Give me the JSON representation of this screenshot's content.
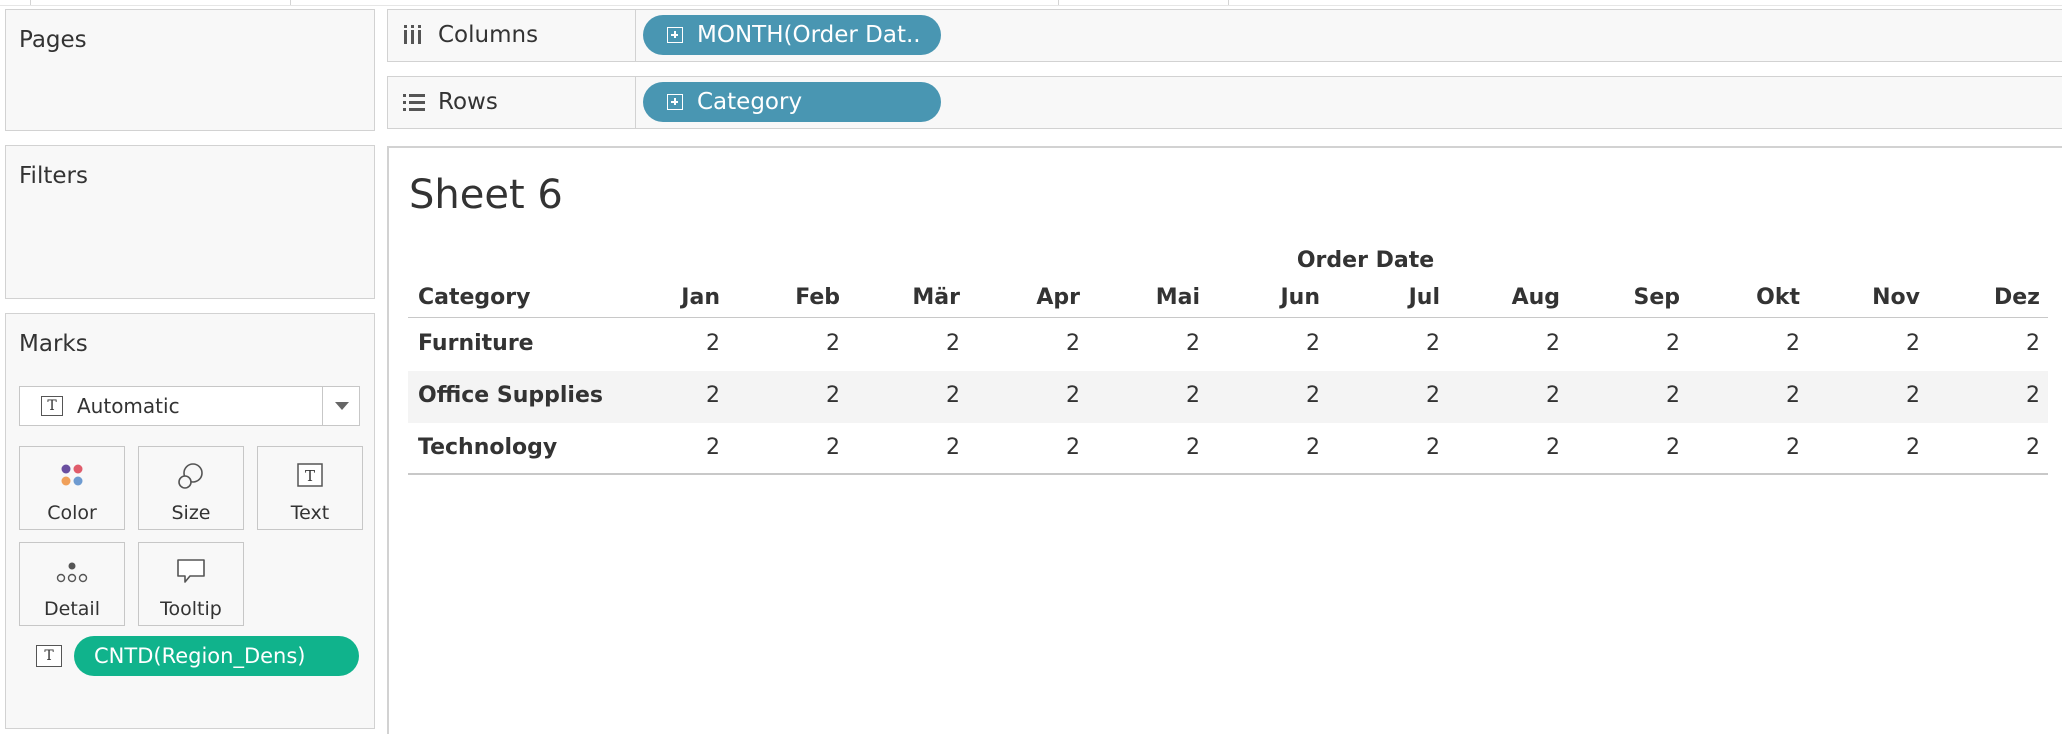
{
  "shelves": {
    "pages_title": "Pages",
    "filters_title": "Filters",
    "columns": {
      "label": "Columns",
      "pill": "MONTH(Order Dat.."
    },
    "rows": {
      "label": "Rows",
      "pill": "Category"
    }
  },
  "marks": {
    "title": "Marks",
    "mark_type": "Automatic",
    "buttons": {
      "color": "Color",
      "size": "Size",
      "text": "Text",
      "detail": "Detail",
      "tooltip": "Tooltip"
    },
    "text_pill": "CNTD(Region_Dens)",
    "t_glyph": "T"
  },
  "view": {
    "sheet_title": "Sheet 6",
    "column_header": "Order Date",
    "row_header": "Category",
    "months": [
      "Jan",
      "Feb",
      "Mär",
      "Apr",
      "Mai",
      "Jun",
      "Jul",
      "Aug",
      "Sep",
      "Okt",
      "Nov",
      "Dez"
    ],
    "rows": [
      {
        "category": "Furniture",
        "values": [
          "2",
          "2",
          "2",
          "2",
          "2",
          "2",
          "2",
          "2",
          "2",
          "2",
          "2",
          "2"
        ]
      },
      {
        "category": "Office Supplies",
        "values": [
          "2",
          "2",
          "2",
          "2",
          "2",
          "2",
          "2",
          "2",
          "2",
          "2",
          "2",
          "2"
        ]
      },
      {
        "category": "Technology",
        "values": [
          "2",
          "2",
          "2",
          "2",
          "2",
          "2",
          "2",
          "2",
          "2",
          "2",
          "2",
          "2"
        ]
      }
    ]
  },
  "colors": {
    "dimension_pill": "#4996b2",
    "measure_pill": "#10b38c"
  },
  "icons": {
    "columns": "columns-icon",
    "rows": "rows-icon",
    "color": "color-palette-icon",
    "size": "size-circles-icon",
    "text": "text-t-icon",
    "detail": "detail-dots-icon",
    "tooltip": "tooltip-bubble-icon",
    "expand": "plus-box-icon",
    "dropdown": "chevron-down-icon"
  }
}
